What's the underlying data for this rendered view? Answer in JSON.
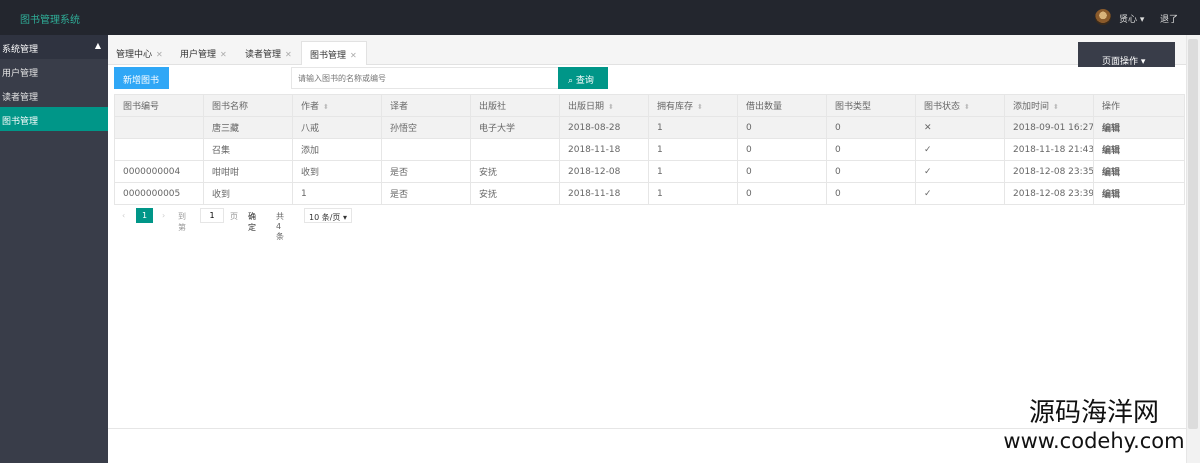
{
  "app": {
    "title": "图书管理系统",
    "user": "贤心",
    "logout": "退了"
  },
  "sidebar": {
    "group": "系统管理",
    "items": [
      {
        "label": "用户管理"
      },
      {
        "label": "读者管理"
      },
      {
        "label": "图书管理"
      }
    ]
  },
  "tabs": [
    {
      "label": "管理中心"
    },
    {
      "label": "用户管理"
    },
    {
      "label": "读者管理"
    },
    {
      "label": "图书管理"
    }
  ],
  "toolbar": {
    "page_ops": "页面操作",
    "add_label": "新增图书",
    "search_placeholder": "请输入图书的名称或编号",
    "search_label": "查询"
  },
  "table": {
    "headers": [
      "图书编号",
      "图书名称",
      "作者",
      "译者",
      "出版社",
      "出版日期",
      "拥有库存",
      "借出数量",
      "图书类型",
      "图书状态",
      "添加时间",
      "操作"
    ],
    "rows": [
      {
        "id": "",
        "name": "唐三藏",
        "author": "八戒",
        "translator": "孙悟空",
        "publisher": "电子大学",
        "date": "2018-08-28",
        "stock": "1",
        "lent": "0",
        "type": "0",
        "status": "✕",
        "added": "2018-09-01 16:27",
        "action": "编辑"
      },
      {
        "id": "",
        "name": "召集",
        "author": "添加",
        "translator": "",
        "publisher": "",
        "date": "2018-11-18",
        "stock": "1",
        "lent": "0",
        "type": "0",
        "status": "✓",
        "added": "2018-11-18 21:43",
        "action": "编辑"
      },
      {
        "id": "0000000004",
        "name": "咁咁咁",
        "author": "收到",
        "translator": "是否",
        "publisher": "安抚",
        "date": "2018-12-08",
        "stock": "1",
        "lent": "0",
        "type": "0",
        "status": "✓",
        "added": "2018-12-08 23:35",
        "action": "编辑"
      },
      {
        "id": "0000000005",
        "name": "收到",
        "author": "1",
        "translator": "是否",
        "publisher": "安抚",
        "date": "2018-11-18",
        "stock": "1",
        "lent": "0",
        "type": "0",
        "status": "✓",
        "added": "2018-12-08 23:39",
        "action": "编辑"
      }
    ]
  },
  "pager": {
    "current": "1",
    "goto_label": "到第",
    "goto_value": "1",
    "page_label": "页",
    "confirm": "确定",
    "total": "共 4 条",
    "page_size": "10 条/页"
  },
  "watermark": {
    "line1": "源码海洋网",
    "line2": "www.codehy.com"
  }
}
